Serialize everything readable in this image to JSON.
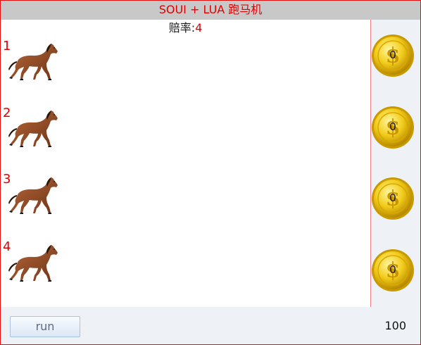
{
  "window": {
    "title": "SOUI + LUA 跑马机"
  },
  "odds": {
    "label": "赔率:",
    "value": "4"
  },
  "lanes": [
    {
      "number": "1",
      "bet": "0"
    },
    {
      "number": "2",
      "bet": "0"
    },
    {
      "number": "3",
      "bet": "0"
    },
    {
      "number": "4",
      "bet": "0"
    }
  ],
  "controls": {
    "run_label": "run",
    "balance": "100"
  },
  "icons": {
    "horse": "horse-icon",
    "coin": "dollar-coin-icon"
  },
  "colors": {
    "title_text": "#e00000",
    "lane_number": "#e00000",
    "border": "#e01010"
  }
}
